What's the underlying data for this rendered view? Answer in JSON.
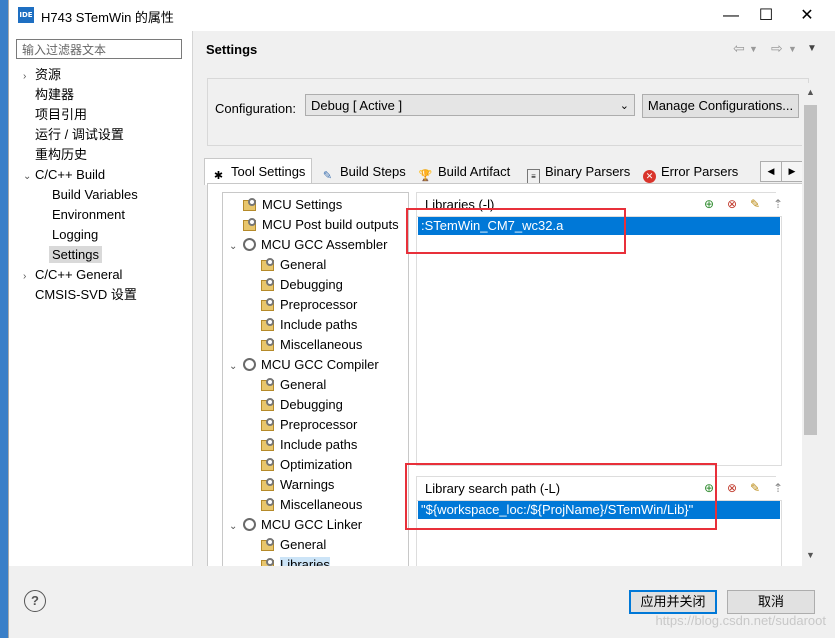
{
  "window": {
    "title": "H743 STemWin 的属性",
    "app_icon": "IDE"
  },
  "left_panel": {
    "filter_placeholder": "输入过滤器文本",
    "items": [
      {
        "label": "资源",
        "expand": "›"
      },
      {
        "label": "构建器"
      },
      {
        "label": "项目引用"
      },
      {
        "label": "运行 / 调试设置"
      },
      {
        "label": "重构历史"
      },
      {
        "label": "C/C++ Build",
        "expand": "⌄"
      },
      {
        "label": "Build Variables"
      },
      {
        "label": "Environment"
      },
      {
        "label": "Logging"
      },
      {
        "label": "Settings"
      },
      {
        "label": "C/C++ General",
        "expand": "›"
      },
      {
        "label": "CMSIS-SVD 设置"
      }
    ]
  },
  "header": {
    "title": "Settings"
  },
  "configuration": {
    "label": "Configuration:",
    "value": "Debug  [ Active ]",
    "manage_label": "Manage Configurations..."
  },
  "tabs": [
    {
      "label": "Tool Settings"
    },
    {
      "label": "Build Steps"
    },
    {
      "label": "Build Artifact"
    },
    {
      "label": "Binary Parsers"
    },
    {
      "label": "Error Parsers"
    }
  ],
  "tool_tree": [
    {
      "label": "MCU Settings"
    },
    {
      "label": "MCU Post build outputs"
    },
    {
      "label": "MCU GCC Assembler",
      "expand": "⌄"
    },
    {
      "label": "General"
    },
    {
      "label": "Debugging"
    },
    {
      "label": "Preprocessor"
    },
    {
      "label": "Include paths"
    },
    {
      "label": "Miscellaneous"
    },
    {
      "label": "MCU GCC Compiler",
      "expand": "⌄"
    },
    {
      "label": "General"
    },
    {
      "label": "Debugging"
    },
    {
      "label": "Preprocessor"
    },
    {
      "label": "Include paths"
    },
    {
      "label": "Optimization"
    },
    {
      "label": "Warnings"
    },
    {
      "label": "Miscellaneous"
    },
    {
      "label": "MCU GCC Linker",
      "expand": "⌄"
    },
    {
      "label": "General"
    },
    {
      "label": "Libraries"
    }
  ],
  "libraries": {
    "label": "Libraries (-l)",
    "entry": ":STemWin_CM7_wc32.a"
  },
  "library_search": {
    "label": "Library search path (-L)",
    "entry": "\"${workspace_loc:/${ProjName}/STemWin/Lib}\""
  },
  "buttons": {
    "apply_close": "应用并关闭",
    "cancel": "取消"
  },
  "watermark": "https://blog.csdn.net/sudaroot"
}
